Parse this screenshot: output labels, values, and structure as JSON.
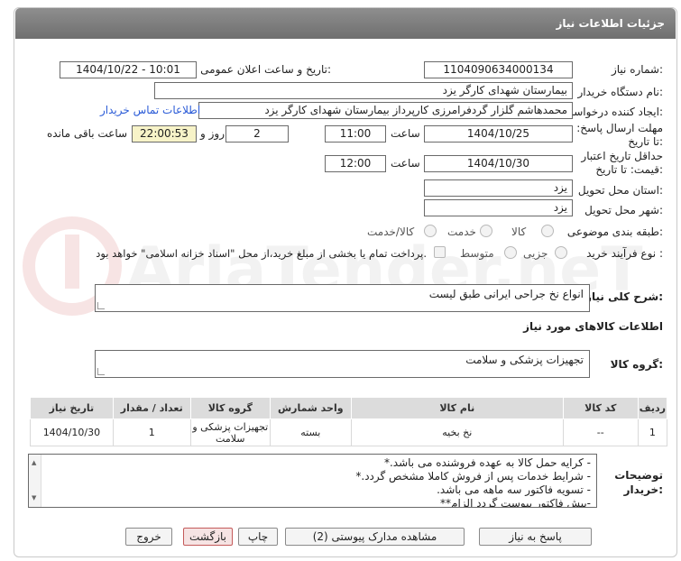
{
  "header": {
    "title": "جزئیات اطلاعات نیاز"
  },
  "form": {
    "need_number_label": "شماره نیاز:",
    "need_number": "1104090634000134",
    "announce_label": "تاریخ و ساعت اعلان عمومی:",
    "announce_value": "1404/10/22 - 10:01",
    "buyer_label": "نام دستگاه خریدار:",
    "buyer_value": "بیمارستان شهدای کارگر یزد",
    "requester_label": "ایجاد کننده درخواست:",
    "requester_value": "محمدهاشم گلزار گردفرامرزی کارپرداز بیمارستان شهدای کارگر یزد",
    "contact_link": "اطلاعات تماس خریدار",
    "deadline_label": "مهلت ارسال پاسخ: تا تاریخ:",
    "deadline_date": "1404/10/25",
    "time_label": "ساعت",
    "deadline_time": "11:00",
    "days_value": "2",
    "days_label": "روز و",
    "remaining_value": "22:00:53",
    "remaining_label": "ساعت باقی مانده",
    "validity_label": "حداقل تاریخ اعتبار قیمت: تا تاریخ:",
    "validity_date": "1404/10/30",
    "validity_time": "12:00",
    "province_label": "استان محل تحویل:",
    "province_value": "یزد",
    "city_label": "شهر محل تحویل:",
    "city_value": "یزد",
    "category_label": "طبقه بندی موضوعی:",
    "category_options": [
      "کالا",
      "خدمت",
      "کالا/خدمت"
    ],
    "purchase_type_label": "نوع فرآیند خرید :",
    "purchase_options": [
      "جزیی",
      "متوسط"
    ],
    "payment_note": "پرداخت تمام یا بخشی از مبلغ خرید،از محل \"اسناد خزانه اسلامی\" خواهد بود."
  },
  "description": {
    "label": "شرح کلی نیاز:",
    "value": "انواع نخ جراحی ایرانی طبق لیست"
  },
  "goods": {
    "section_label": "اطلاعات کالاهای مورد نیاز",
    "group_label": "گروه کالا:",
    "group_value": "تجهیزات پزشکی و سلامت"
  },
  "table": {
    "headers": [
      "ردیف",
      "کد کالا",
      "نام کالا",
      "واحد شمارش",
      "گروه کالا",
      "تعداد / مقدار",
      "تاریخ نیاز"
    ],
    "rows": [
      [
        "1",
        "--",
        "نخ بخیه",
        "بسته",
        "تجهیزات پزشکی و سلامت",
        "1",
        "1404/10/30"
      ]
    ]
  },
  "notes": {
    "label": "توضیحات خریدار:",
    "lines": [
      "- کرایه حمل  کالا به عهده فروشنده می باشد.*",
      "- شرایط خدمات پس از فروش کاملا مشخص گردد.*",
      "- تسویه فاکتور سه ماهه می باشد.",
      "-پیش فاکتور پیوست گردد  الزام**"
    ]
  },
  "buttons": {
    "reply": "پاسخ به نیاز",
    "attachments": "مشاهده مدارک پیوستی (2)",
    "print": "چاپ",
    "back": "بازگشت",
    "exit": "خروج"
  },
  "watermark": {
    "text": "AriaTender.neT"
  },
  "colors": {
    "title_bar": "#7f7f7f",
    "link": "#2a5bd7",
    "yellow_box": "#f7f3c8",
    "table_header": "#dcdcdc"
  }
}
